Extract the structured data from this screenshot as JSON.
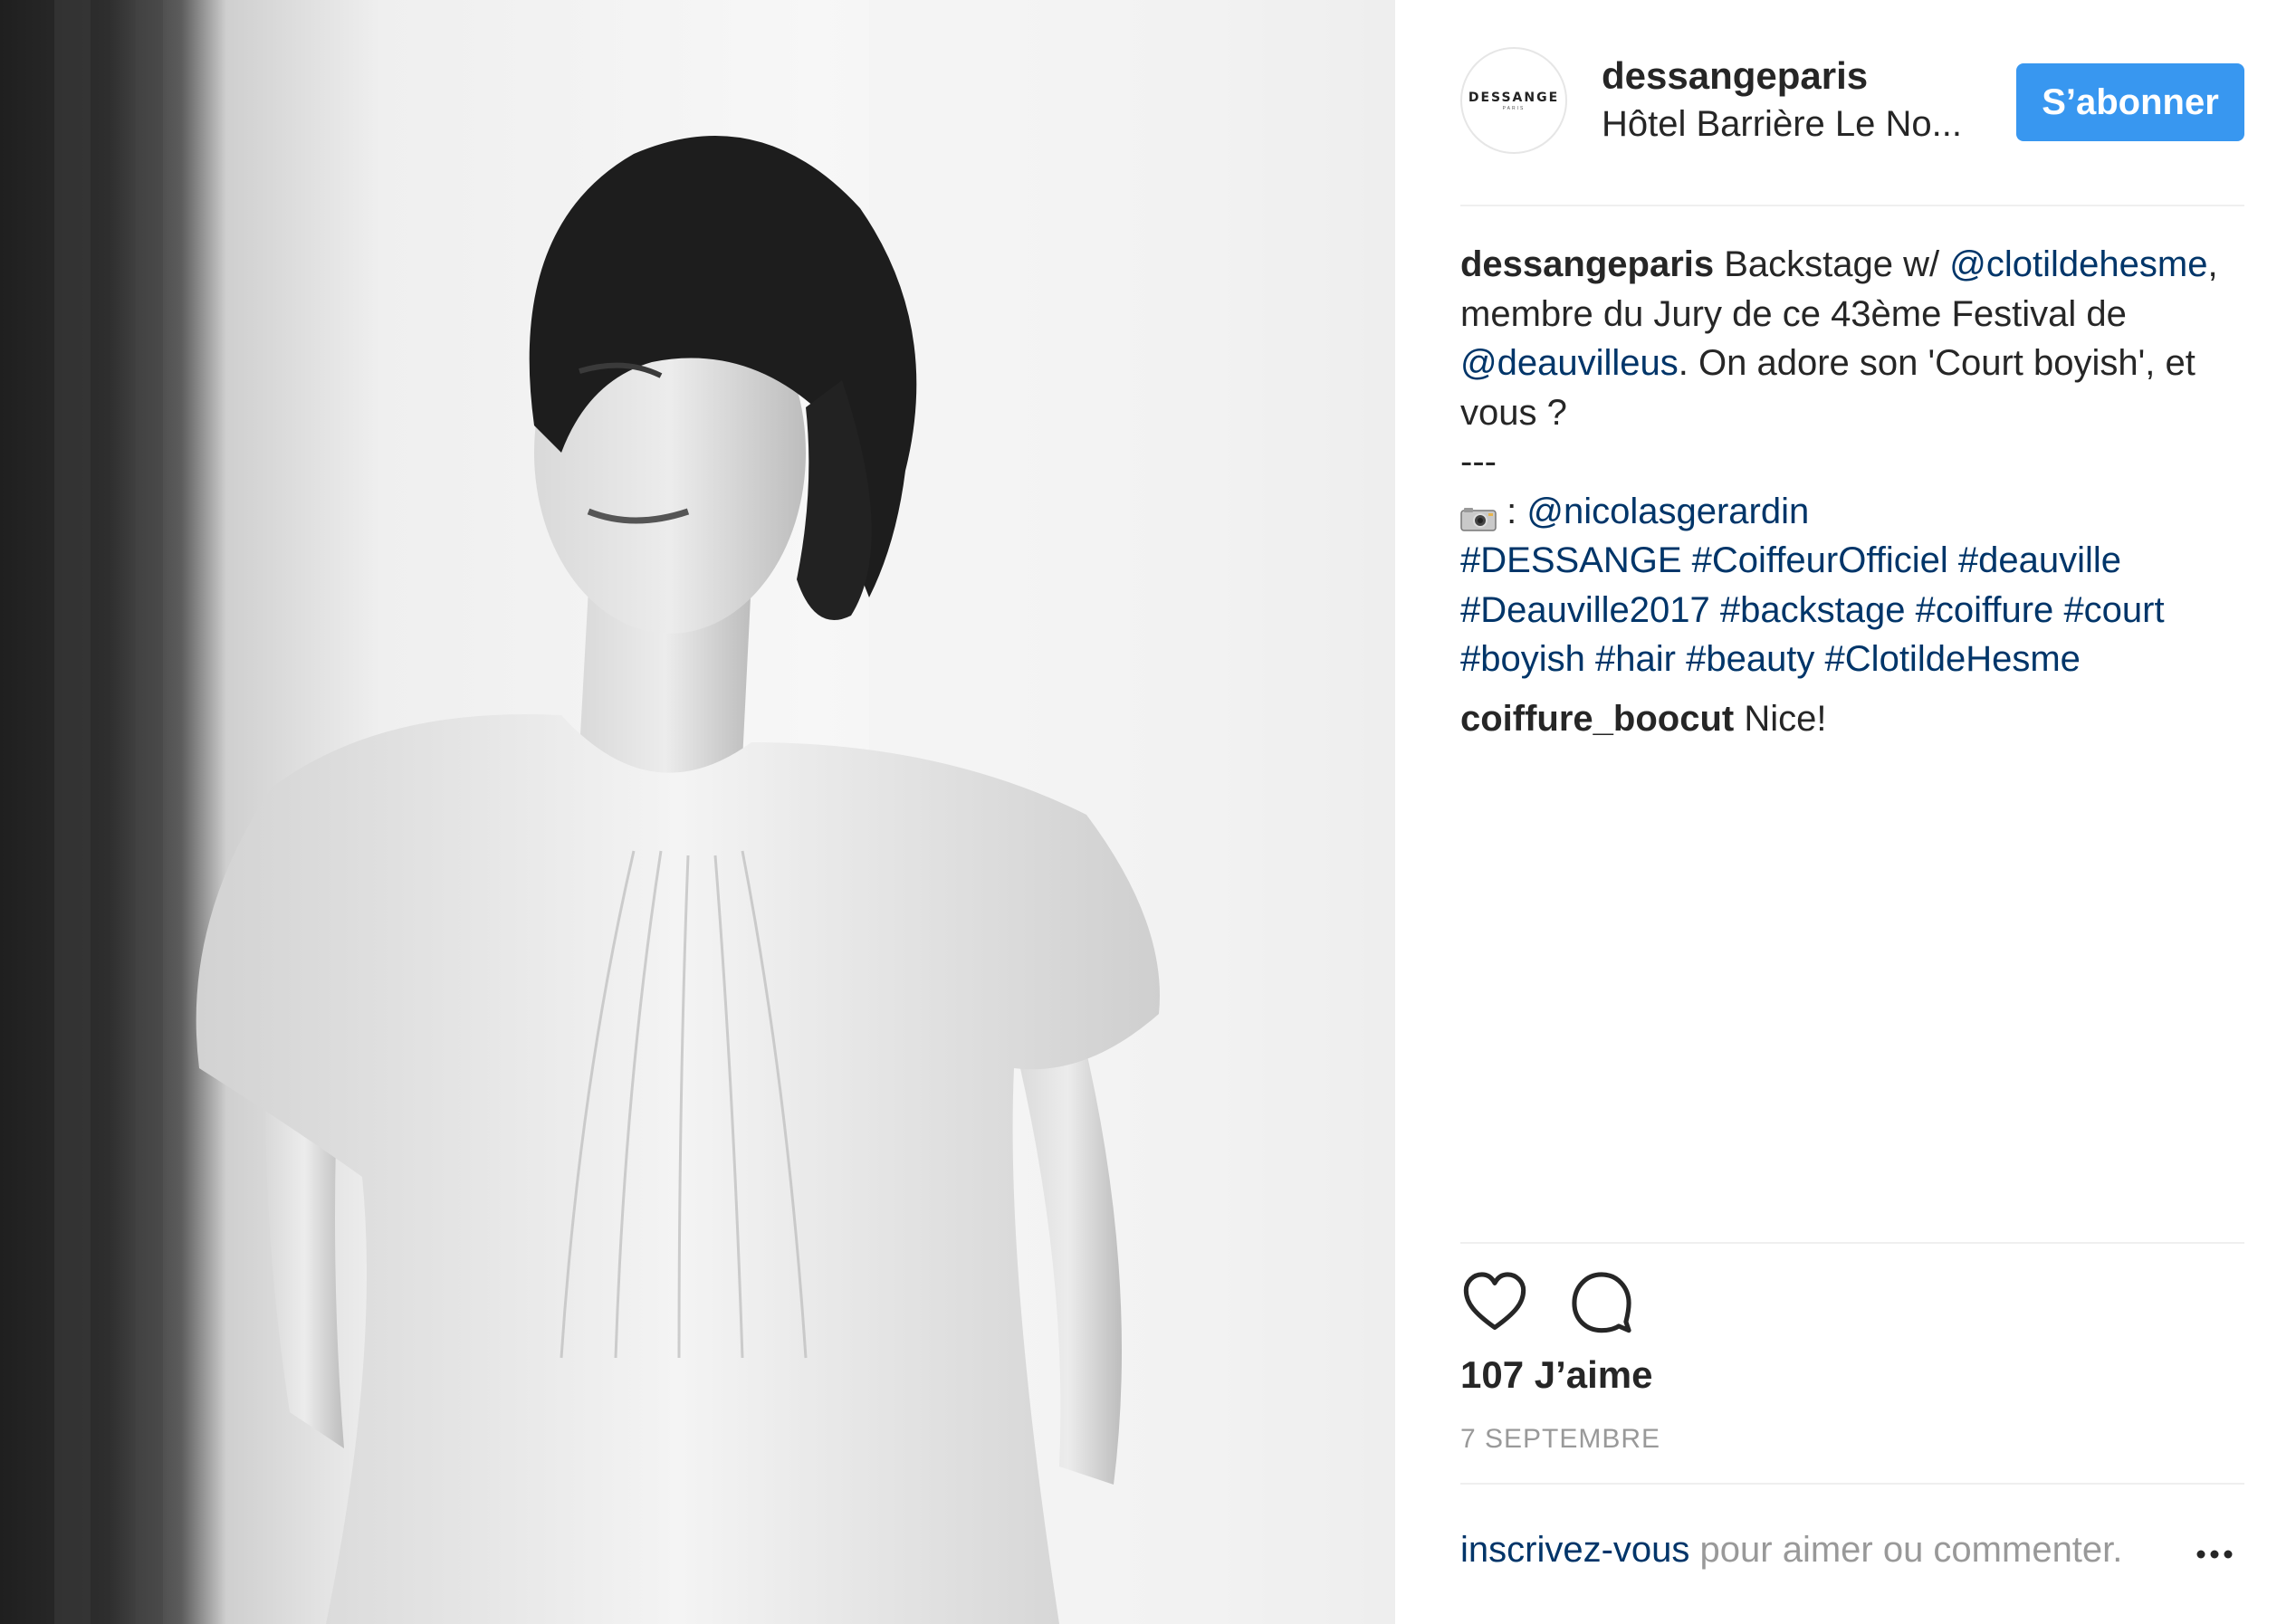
{
  "post": {
    "username": "dessangeparis",
    "location": "Hôtel Barrière Le No...",
    "follow_label": "S’abonner",
    "avatar_brand": "DESSANGE",
    "avatar_brand_sub": "PARIS",
    "caption": {
      "author": "dessangeparis",
      "text1": " Backstage w/ ",
      "mention1": "@clotildehesme",
      "text2": ", membre du Jury de ce 43ème Festival de ",
      "mention2": "@deauvilleus",
      "text3": ". On adore son 'Court boyish', et vous ?",
      "separator": "---",
      "photo_credit_sep": " : ",
      "mention3": "@nicolasgerardin",
      "hashtags": [
        "#DESSANGE",
        "#CoiffeurOfficiel",
        "#deauville",
        "#Deauville2017",
        "#backstage",
        "#coiffure",
        "#court",
        "#boyish",
        "#hair",
        "#beauty",
        "#ClotildeHesme"
      ]
    },
    "comment": {
      "author": "coiffure_boocut",
      "text": " Nice!"
    },
    "likes": "107 J’aime",
    "date": "7 SEPTEMBRE",
    "footer": {
      "signup_link": "inscrivez-vous",
      "text": " pour aimer ou commenter."
    }
  },
  "icons": {
    "like": "heart-icon",
    "comment": "speech-bubble-icon",
    "more": "more-options-icon",
    "camera": "camera-emoji-icon"
  },
  "colors": {
    "accent": "#3897f0",
    "link": "#003569",
    "text": "#262626",
    "muted": "#999999",
    "divider": "#efefef"
  }
}
